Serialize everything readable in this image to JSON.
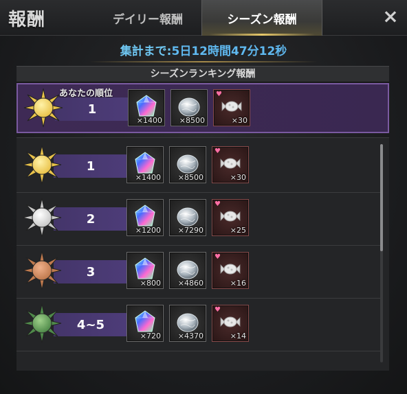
{
  "header": {
    "title": "報酬",
    "tabs": [
      {
        "label": "デイリー報酬",
        "active": false
      },
      {
        "label": "シーズン報酬",
        "active": true
      }
    ],
    "close_icon": "×"
  },
  "countdown": {
    "label": "集計まで:",
    "value": "5日12時間47分12秒"
  },
  "section": {
    "title": "シーズンランキング報酬"
  },
  "my_rank": {
    "caption": "あなたの順位",
    "rank": "1",
    "medal": "gold",
    "rewards": [
      {
        "icon": "gem-icon",
        "qty": "×1400"
      },
      {
        "icon": "silver-ore-icon",
        "qty": "×8500"
      },
      {
        "icon": "candy-icon",
        "qty": "×30"
      }
    ]
  },
  "ranks": [
    {
      "rank": "1",
      "medal": "gold",
      "rewards": [
        {
          "icon": "gem-icon",
          "qty": "×1400"
        },
        {
          "icon": "silver-ore-icon",
          "qty": "×8500"
        },
        {
          "icon": "candy-icon",
          "qty": "×30"
        }
      ]
    },
    {
      "rank": "2",
      "medal": "silver",
      "rewards": [
        {
          "icon": "gem-icon",
          "qty": "×1200"
        },
        {
          "icon": "silver-ore-icon",
          "qty": "×7290"
        },
        {
          "icon": "candy-icon",
          "qty": "×25"
        }
      ]
    },
    {
      "rank": "3",
      "medal": "bronze",
      "rewards": [
        {
          "icon": "gem-icon",
          "qty": "×800"
        },
        {
          "icon": "silver-ore-icon",
          "qty": "×4860"
        },
        {
          "icon": "candy-icon",
          "qty": "×16"
        }
      ]
    },
    {
      "rank": "4~5",
      "medal": "green",
      "rewards": [
        {
          "icon": "gem-icon",
          "qty": "×720"
        },
        {
          "icon": "silver-ore-icon",
          "qty": "×4370"
        },
        {
          "icon": "candy-icon",
          "qty": "×14"
        }
      ]
    }
  ],
  "colors": {
    "accent_blue": "#5fb8ef",
    "rank_banner": "#4e3d7a",
    "my_row_bg": "#3e2a55",
    "gold": "#e9c24a",
    "silver": "#c8c8c8",
    "bronze": "#c07a4e",
    "green": "#4f8a4a"
  }
}
